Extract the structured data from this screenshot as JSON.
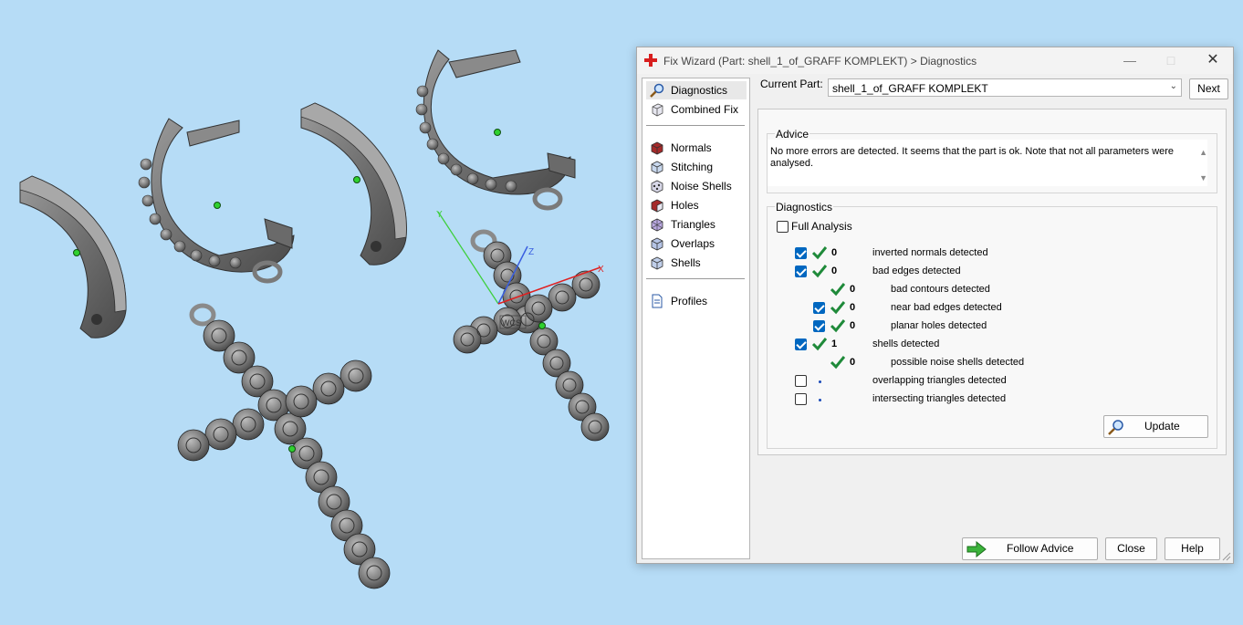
{
  "window": {
    "title": "Fix Wizard (Part: shell_1_of_GRAFF KOMPLEKT) > Diagnostics",
    "minimize_icon": "minimize-icon",
    "maximize_icon": "maximize-icon",
    "close_icon": "close-icon"
  },
  "viewport": {
    "axis_y": "Y",
    "axis_z": "Z",
    "axis_x": "X",
    "wcs": "WCS"
  },
  "nav": {
    "items": [
      {
        "label": "Diagnostics",
        "icon": "magnifier-icon",
        "active": true
      },
      {
        "label": "Combined Fix",
        "icon": "cube-icon"
      },
      {
        "label": "Normals",
        "icon": "normals-cube-icon"
      },
      {
        "label": "Stitching",
        "icon": "stitching-cube-icon"
      },
      {
        "label": "Noise Shells",
        "icon": "noise-shells-icon"
      },
      {
        "label": "Holes",
        "icon": "holes-cube-icon"
      },
      {
        "label": "Triangles",
        "icon": "triangles-cube-icon"
      },
      {
        "label": "Overlaps",
        "icon": "overlaps-cube-icon"
      },
      {
        "label": "Shells",
        "icon": "shells-cube-icon"
      },
      {
        "label": "Profiles",
        "icon": "document-icon"
      }
    ]
  },
  "current_part": {
    "label": "Current Part:",
    "value": "shell_1_of_GRAFF KOMPLEKT",
    "next_label": "Next"
  },
  "advice": {
    "title": "Advice",
    "text": "No more errors are detected. It seems that the part is ok. Note that not all parameters were analysed."
  },
  "diagnostics": {
    "title": "Diagnostics",
    "full_analysis_label": "Full Analysis",
    "full_analysis_checked": false,
    "rows": [
      {
        "checked": true,
        "status": "ok",
        "count": "0",
        "label": "inverted normals detected"
      },
      {
        "checked": true,
        "status": "ok",
        "count": "0",
        "label": "bad edges detected"
      },
      {
        "checked": null,
        "status": "ok",
        "count": "0",
        "label": "bad contours detected"
      },
      {
        "checked": true,
        "status": "ok",
        "count": "0",
        "label": "near bad edges detected"
      },
      {
        "checked": true,
        "status": "ok",
        "count": "0",
        "label": "planar holes detected"
      },
      {
        "checked": true,
        "status": "ok",
        "count": "1",
        "label": "shells detected"
      },
      {
        "checked": null,
        "status": "ok",
        "count": "0",
        "label": "possible noise shells detected"
      },
      {
        "checked": false,
        "status": "pending",
        "count": "",
        "label": "overlapping triangles detected"
      },
      {
        "checked": false,
        "status": "pending",
        "count": "",
        "label": "intersecting triangles detected"
      }
    ],
    "update_label": "Update"
  },
  "footer": {
    "follow_advice_label": "Follow Advice",
    "close_label": "Close",
    "help_label": "Help"
  },
  "colors": {
    "background": "#b6dcf6",
    "model": "#8c8c8c",
    "check_green": "#1f8a3a",
    "accent_blue": "#0067c0"
  }
}
